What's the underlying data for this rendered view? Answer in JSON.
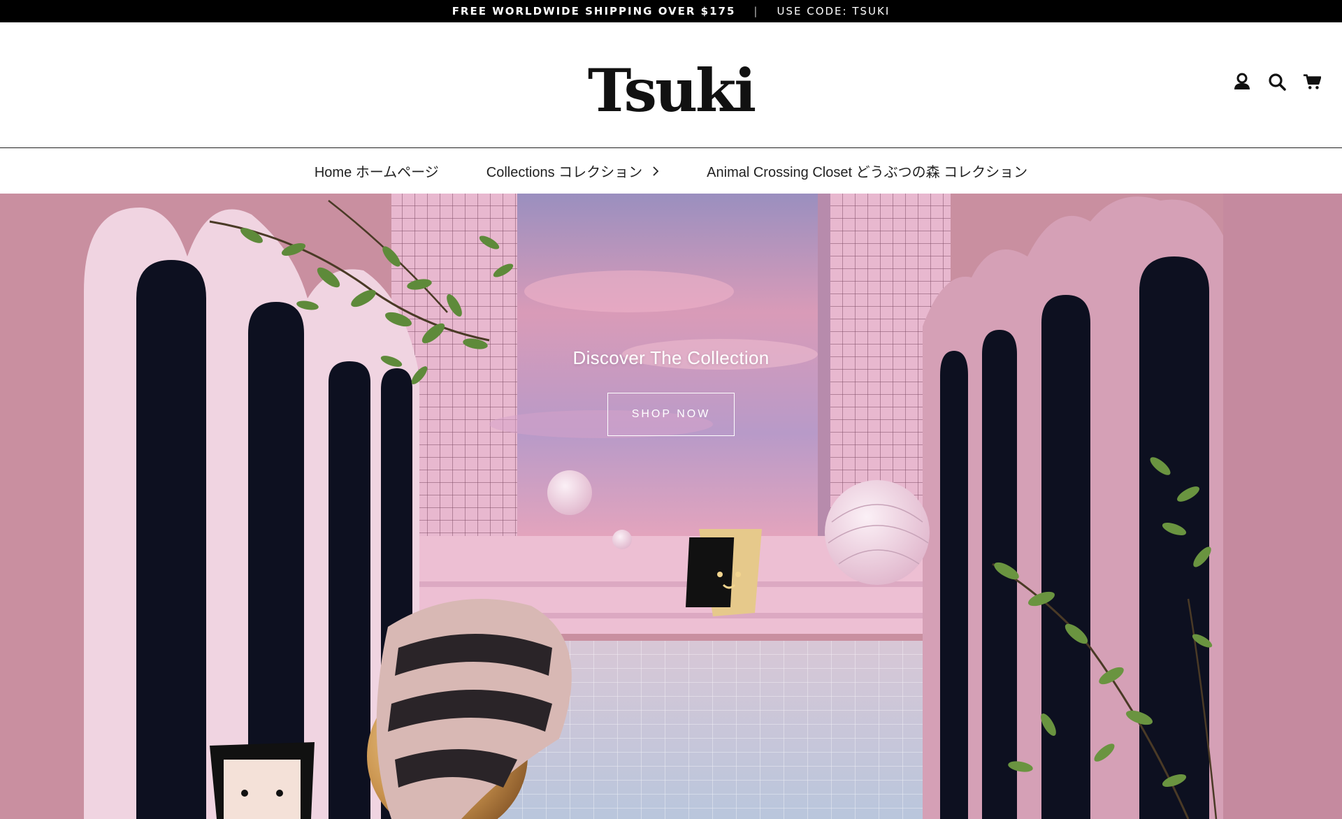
{
  "announcement": {
    "shipping": "FREE WORLDWIDE SHIPPING OVER $175",
    "separator": "|",
    "code": "USE CODE: TSUKI"
  },
  "header": {
    "logo": "Tsuki",
    "icons": [
      "account-icon",
      "search-icon",
      "cart-icon"
    ]
  },
  "nav": {
    "items": [
      {
        "label": "Home ホームページ"
      },
      {
        "label": "Collections コレクション",
        "icon": "chevron-right-icon"
      },
      {
        "label": "Animal Crossing Closet どうぶつの森 コレクション"
      }
    ]
  },
  "hero": {
    "title": "Discover The Collection",
    "button": "SHOP NOW"
  },
  "colors": {
    "announce_bg": "#000000",
    "hero_pink": "#c98fa0",
    "text_dark": "#111111"
  }
}
